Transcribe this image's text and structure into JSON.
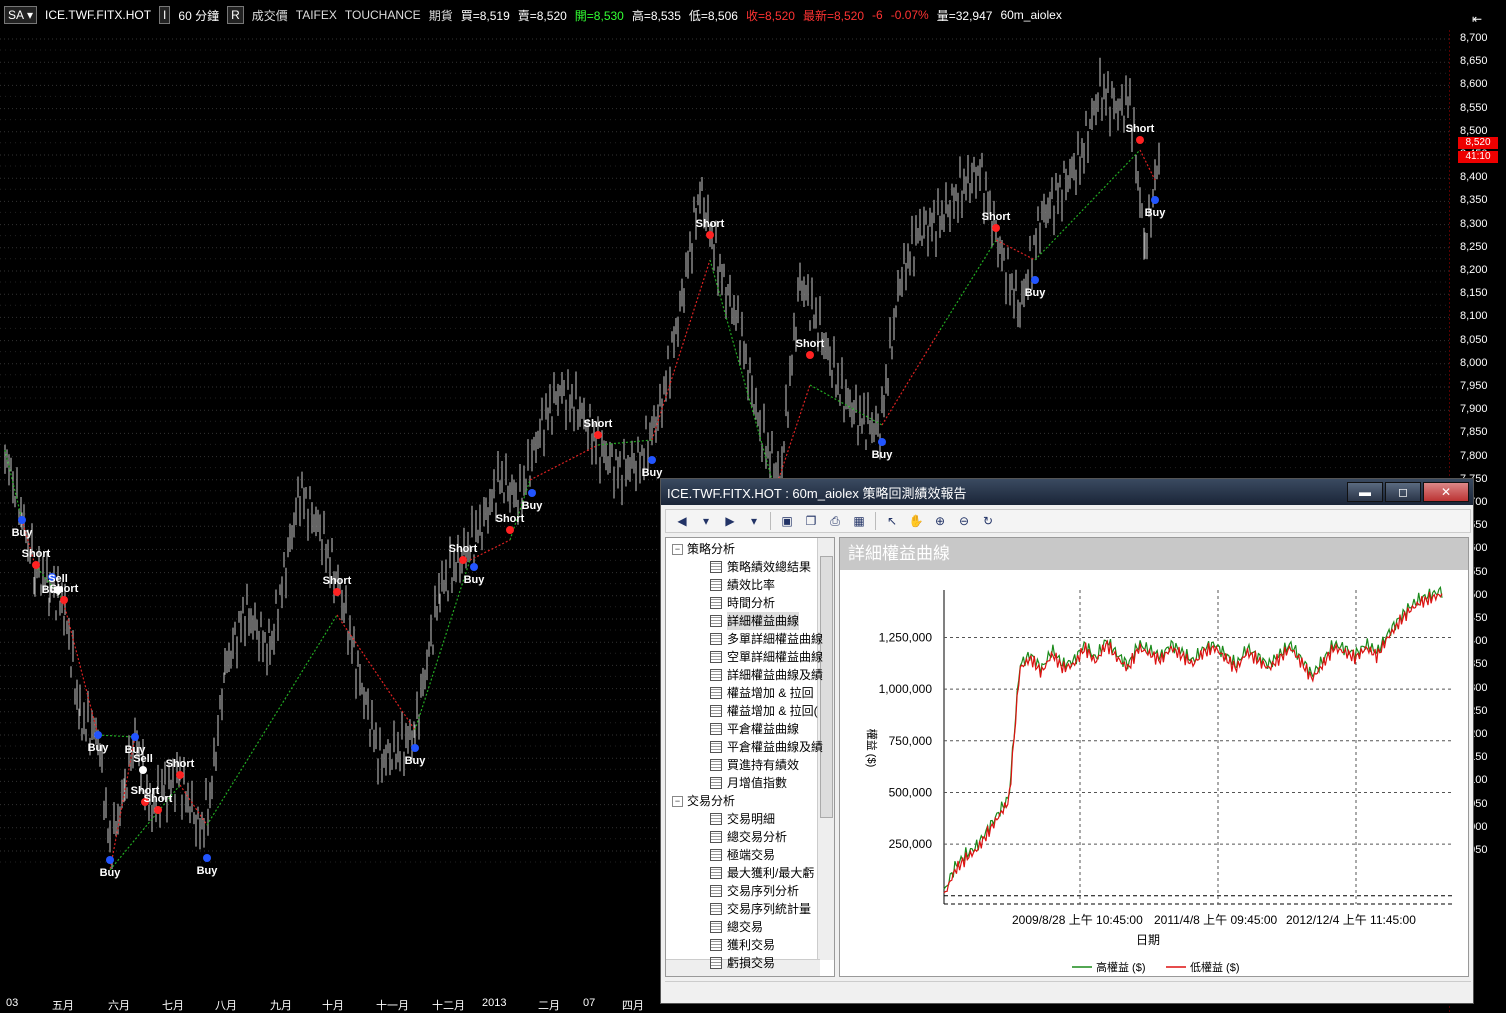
{
  "topbar": {
    "mode": "SA",
    "symbol": "ICE.TWF.FITX.HOT",
    "interval_btn": "I",
    "interval": "60 分鐘",
    "chart_btn": "R",
    "price_type": "成交價",
    "exchange": "TAIFEX",
    "product": "TOUCHANCE",
    "category": "期貨",
    "bid": "買=8,519",
    "ask": "賣=8,520",
    "open": "開=8,530",
    "high": "高=8,535",
    "low": "低=8,506",
    "close": "收=8,520",
    "last": "最新=8,520",
    "change": "-6",
    "change_pct": "-0.07%",
    "volume": "量=32,947",
    "strategy": "60m_aiolex"
  },
  "price_axis": {
    "labels": [
      "8,700",
      "8,650",
      "8,600",
      "8,550",
      "8,500",
      "8,450",
      "8,400",
      "8,350",
      "8,300",
      "8,250",
      "8,200",
      "8,150",
      "8,100",
      "8,050",
      "8,000",
      "7,950",
      "7,900",
      "7,850",
      "7,800",
      "7,750",
      "7,700",
      "7,650",
      "7,600",
      "7,550",
      "7,500",
      "7,450",
      "7,400",
      "7,350",
      "7,300",
      "7,250",
      "7,200",
      "7,150",
      "7,100",
      "7,050",
      "7,000",
      "6,950"
    ],
    "flag_price": "8,520",
    "flag_time": "41:10",
    "collapse_icon": "⇤"
  },
  "time_axis": [
    "03",
    "五月",
    "六月",
    "七月",
    "八月",
    "九月",
    "十月",
    "十一月",
    "十二月",
    "2013",
    "二月",
    "07",
    "四月"
  ],
  "signals": [
    {
      "label": "Buy"
    },
    {
      "label": "Short"
    },
    {
      "label": "Buy"
    },
    {
      "label": "Sell"
    },
    {
      "label": "Short"
    },
    {
      "label": "Buy"
    },
    {
      "label": "Buy"
    },
    {
      "label": "Sell"
    },
    {
      "label": "Short"
    },
    {
      "label": "Buy"
    },
    {
      "label": "Short"
    },
    {
      "label": "Short"
    },
    {
      "label": "Buy"
    },
    {
      "label": "Short"
    },
    {
      "label": "Buy"
    },
    {
      "label": "Short"
    },
    {
      "label": "Buy"
    },
    {
      "label": "Short"
    },
    {
      "label": "Buy"
    },
    {
      "label": "Short"
    },
    {
      "label": "Buy"
    },
    {
      "label": "Short"
    },
    {
      "label": "Buy"
    },
    {
      "label": "Short"
    },
    {
      "label": "Buy"
    },
    {
      "label": "Short"
    },
    {
      "label": "Buy"
    },
    {
      "label": "Short"
    },
    {
      "label": "Buy"
    }
  ],
  "dialog": {
    "title": "ICE.TWF.FITX.HOT : 60m_aiolex 策略回測績效報告",
    "minimize": "▬",
    "maximize": "◻",
    "close": "✕",
    "panel_title": "詳細權益曲線",
    "tree": {
      "group1": "策略分析",
      "group1_items": [
        "策略績效總結果",
        "績效比率",
        "時間分析",
        "詳細權益曲線",
        "多單詳細權益曲線",
        "空單詳細權益曲線",
        "詳細權益曲線及績",
        "權益增加 & 拉回",
        "權益增加 & 拉回(",
        "平倉權益曲線",
        "平倉權益曲線及績",
        "買進持有績效",
        "月增值指數"
      ],
      "group2": "交易分析",
      "group2_items": [
        "交易明細",
        "總交易分析",
        "極端交易",
        "最大獲利/最大虧",
        "交易序列分析",
        "交易序列統計量",
        "總交易",
        "獲利交易",
        "虧損交易"
      ]
    },
    "toolbar_icons": [
      "back-icon",
      "dropdown-icon",
      "forward-icon",
      "dropdown-icon",
      "save-icon",
      "copy-icon",
      "print-icon",
      "table-icon",
      "pointer-icon",
      "hand-icon",
      "zoom-in-icon",
      "zoom-out-icon",
      "reset-icon"
    ]
  },
  "chart_data": {
    "type": "line",
    "title": "詳細權益曲線",
    "xlabel": "日期",
    "ylabel": "權益 ($)",
    "x_ticks": [
      "2009/8/28 上午 10:45:00",
      "2011/4/8 上午 09:45:00",
      "2012/12/4 上午 11:45:00"
    ],
    "y_ticks": [
      "250,000",
      "500,000",
      "750,000",
      "1,000,000",
      "1,250,000"
    ],
    "y_values_ticks": [
      250000,
      500000,
      750000,
      1000000,
      1250000
    ],
    "ylim": [
      -40000,
      1480000
    ],
    "series": [
      {
        "name": "高權益 ($)",
        "color": "#1a8a1a"
      },
      {
        "name": "低權益 ($)",
        "color": "#dd1111"
      }
    ],
    "values": [
      0,
      120000,
      180000,
      220000,
      300000,
      380000,
      460000,
      1100000,
      1150000,
      1080000,
      1170000,
      1100000,
      1120000,
      1200000,
      1130000,
      1220000,
      1150000,
      1100000,
      1200000,
      1170000,
      1140000,
      1200000,
      1160000,
      1120000,
      1180000,
      1200000,
      1150000,
      1100000,
      1180000,
      1140000,
      1100000,
      1150000,
      1200000,
      1130000,
      1050000,
      1120000,
      1200000,
      1180000,
      1150000,
      1200000,
      1160000,
      1250000,
      1320000,
      1380000,
      1420000,
      1440000,
      1460000
    ],
    "grid": true,
    "legend": "bottom"
  }
}
